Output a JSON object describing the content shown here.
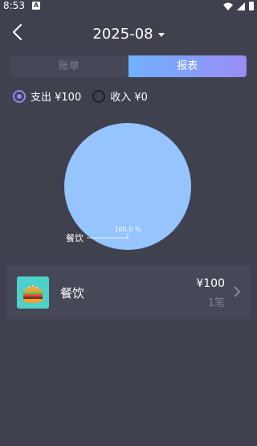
{
  "status_bar": {
    "time": "8:53",
    "notification_glyph": "A"
  },
  "header": {
    "month": "2025-08"
  },
  "tabs": [
    {
      "label": "账单",
      "active": false
    },
    {
      "label": "报表",
      "active": true
    }
  ],
  "filters": {
    "expense_label": "支出 ¥100",
    "expense_selected": true,
    "income_label": "收入 ¥0",
    "income_selected": false
  },
  "chart_data": {
    "type": "pie",
    "slices": [
      {
        "label": "餐饮",
        "value": 100.0,
        "percent_label": "100.0 %",
        "color": "#95c4ff"
      }
    ]
  },
  "categories": [
    {
      "name": "餐饮",
      "amount": "¥100",
      "count": "1笔",
      "icon": "burger-icon"
    }
  ],
  "colors": {
    "background": "#40414f",
    "card": "#474857",
    "accent": "#8f88f3",
    "pie": "#95c4ff",
    "tab_gradient_start": "#6fb2ff",
    "tab_gradient_end": "#9a8cf5",
    "muted": "#7c7e8c"
  }
}
